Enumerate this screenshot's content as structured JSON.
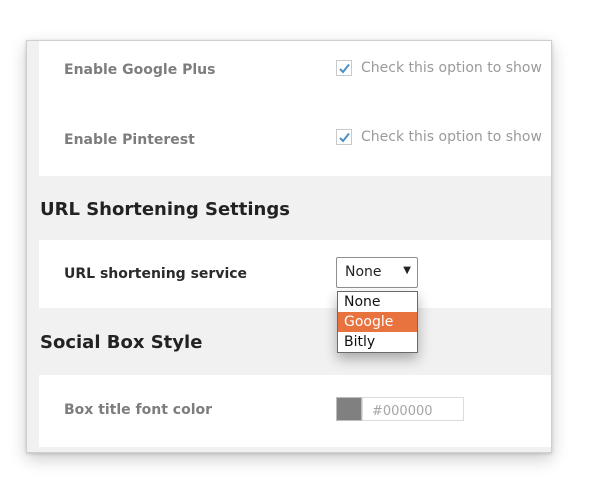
{
  "social_networks": {
    "google_plus": {
      "label": "Enable Google Plus",
      "checked": true,
      "description": "Check this option to show"
    },
    "pinterest": {
      "label": "Enable Pinterest",
      "checked": true,
      "description": "Check this option to show"
    }
  },
  "url_shortening": {
    "section_title": "URL Shortening Settings",
    "service_label": "URL shortening service",
    "selected": "None",
    "options": [
      "None",
      "Google",
      "Bitly"
    ],
    "highlighted_option": "Google"
  },
  "social_box_style": {
    "section_title": "Social Box Style",
    "title_font_color_label": "Box title font color",
    "title_font_color_value": "#000000",
    "swatch_color": "#808080"
  },
  "colors": {
    "accent": "#e8733f",
    "checkmark": "#4a90c2"
  }
}
